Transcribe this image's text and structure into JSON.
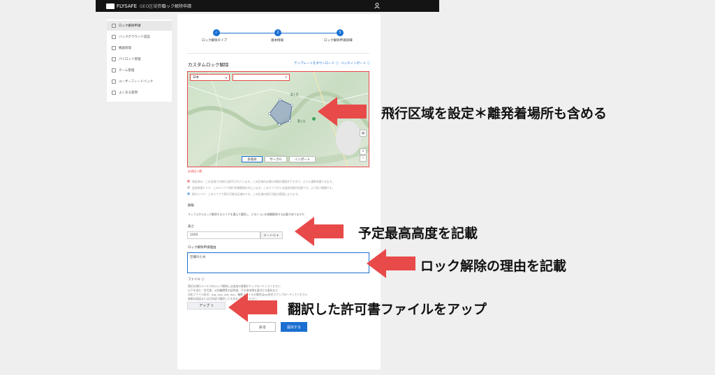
{
  "topbar": {
    "brand": "FLYSAFE",
    "nav_geo": "GEO区域情報",
    "nav_unlock": "ロック解除申請"
  },
  "sidebar": {
    "items": [
      {
        "label": "ロック解除申請",
        "icon": "lock-icon",
        "active": true
      },
      {
        "label": "バックグラウンド認証",
        "icon": "id-card-icon"
      },
      {
        "label": "機器管理",
        "icon": "drone-icon"
      },
      {
        "label": "パイロット管理",
        "icon": "pilot-icon"
      },
      {
        "label": "チーム管理",
        "icon": "team-icon"
      },
      {
        "label": "ユーザーフィードバック",
        "icon": "feedback-icon"
      },
      {
        "label": "よくある質問",
        "icon": "help-icon"
      }
    ]
  },
  "steps": [
    {
      "num": "✓",
      "label": "ロック解除タイプ"
    },
    {
      "num": "2",
      "label": "基本情報"
    },
    {
      "num": "3",
      "label": "ロック解除申請詳細"
    }
  ],
  "custom": {
    "title": "カスタムロック解除",
    "template_link": "テンプレートをダウンロード ⓘ",
    "batch_link": "バッチインポート ⓘ",
    "country_select": "日本",
    "required_note": "必須記入欄",
    "map_place1": "富士宮",
    "map_place2": "富士山",
    "tool_polygon": "多角形",
    "tool_circle": "サークル",
    "tool_import": "インポート",
    "notes": [
      "承認済み：この区域での飛行は許可されています。この区域内は飛行申請の範囲外ですので、よりも通常申請できます。",
      "追加申請エリア：このエリアで飛行申請範囲の外にいます。このエリアからは追加申請が必要です。より短い期間です。",
      "飛行エリア：このエリアで飛行可能な区域内です。この区域の飛行可能な範囲になります。"
    ]
  },
  "period": {
    "label": "期限",
    "desc": "マップ上からロック解除するエリアを選んで選択し、どのくらいの期間解除する必要がありますか"
  },
  "altitude": {
    "label": "高さ",
    "value": "2000",
    "unit": "メートル ▾"
  },
  "reason": {
    "label": "ロック解除申請理由",
    "value": "空撮のため"
  },
  "file": {
    "label": "ファイル ⓘ",
    "desc1": "適切な飛行ルールでのロック解除には追加の書類がアップロードしてください",
    "desc2": "以下を含む：許可書、公的機関等の証明書、その他申請を裏付ける資料など",
    "desc3": "対応ファイル形式：jpg, png, pdf, doc。複数ファイルの場合はzip形式でアップロードしてください",
    "desc4": "書類は英語または日本語で翻訳したものをご提出ください",
    "upload": "アップ ⇧"
  },
  "actions": {
    "back": "戻る",
    "submit": "提出する"
  },
  "annotations": {
    "a1": "飛行区域を設定＊離発着場所も含める",
    "a2": "予定最高高度を記載",
    "a3": "ロック解除の理由を記載",
    "a4": "翻訳した許可書ファイルをアップ"
  },
  "colors": {
    "accent": "#1a6fd1",
    "annotation_red": "#e84a4a"
  }
}
